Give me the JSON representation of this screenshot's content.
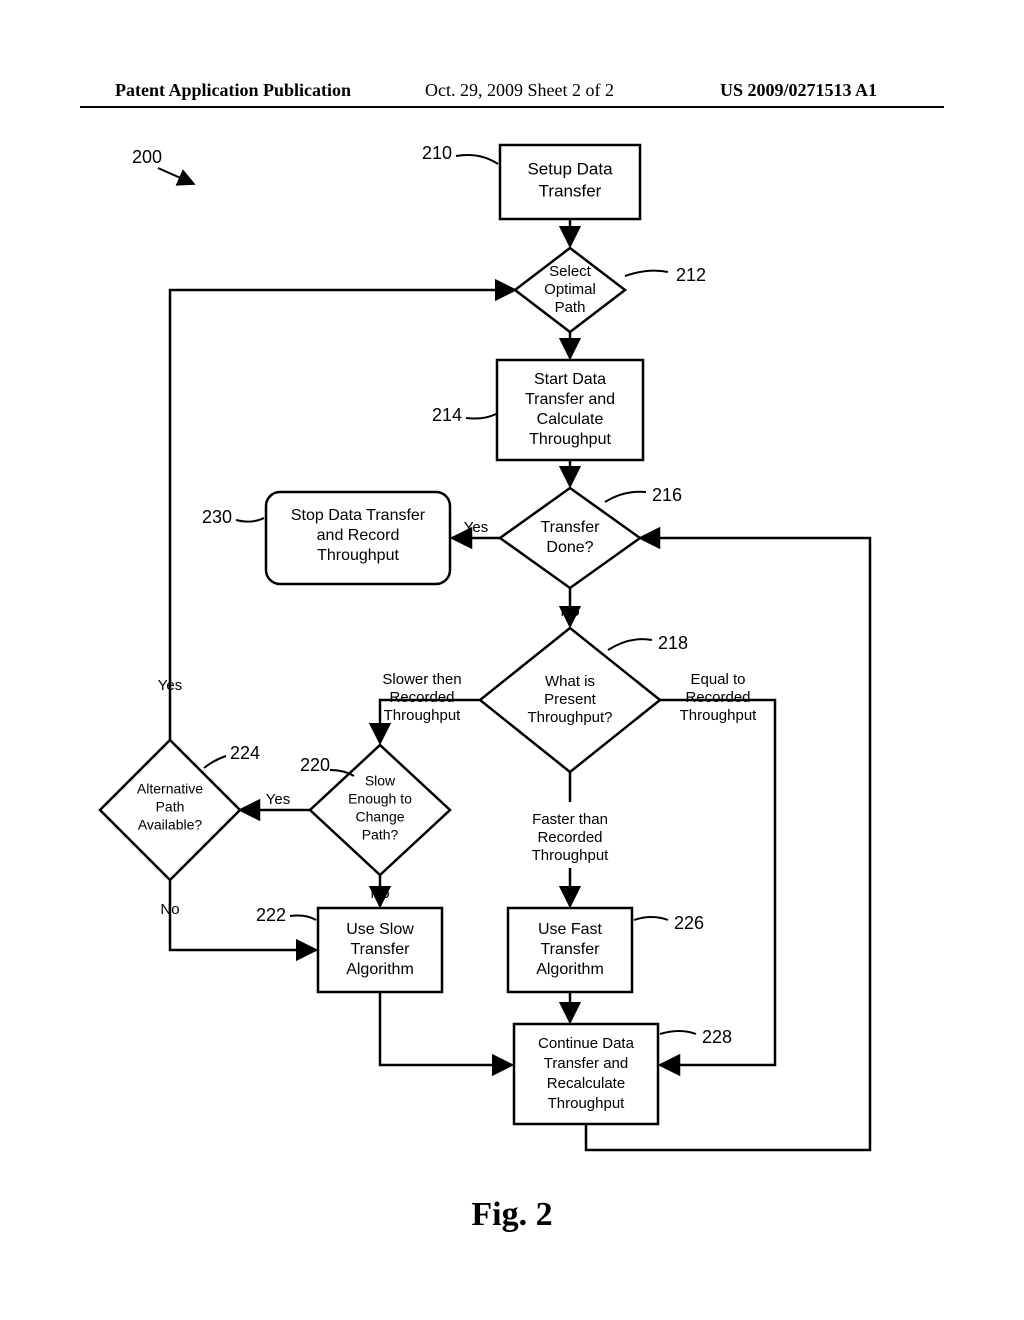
{
  "header": {
    "left": "Patent Application Publication",
    "mid": "Oct. 29, 2009  Sheet 2 of 2",
    "right": "US 2009/0271513 A1"
  },
  "caption": "Fig. 2",
  "refs": {
    "r200": "200",
    "r210": "210",
    "r212": "212",
    "r214": "214",
    "r216": "216",
    "r218": "218",
    "r220": "220",
    "r222": "222",
    "r224": "224",
    "r226": "226",
    "r228": "228",
    "r230": "230"
  },
  "nodes": {
    "n210": {
      "l1": "Setup Data",
      "l2": "Transfer"
    },
    "n212": {
      "l1": "Select",
      "l2": "Optimal",
      "l3": "Path"
    },
    "n214": {
      "l1": "Start Data",
      "l2": "Transfer and",
      "l3": "Calculate",
      "l4": "Throughput"
    },
    "n216": {
      "l1": "Transfer",
      "l2": "Done?"
    },
    "n218": {
      "l1": "What is",
      "l2": "Present",
      "l3": "Throughput?"
    },
    "n220": {
      "l1": "Slow",
      "l2": "Enough to",
      "l3": "Change",
      "l4": "Path?"
    },
    "n222": {
      "l1": "Use Slow",
      "l2": "Transfer",
      "l3": "Algorithm"
    },
    "n224": {
      "l1": "Alternative",
      "l2": "Path",
      "l3": "Available?"
    },
    "n226": {
      "l1": "Use Fast",
      "l2": "Transfer",
      "l3": "Algorithm"
    },
    "n228": {
      "l1": "Continue Data",
      "l2": "Transfer and",
      "l3": "Recalculate",
      "l4": "Throughput"
    },
    "n230": {
      "l1": "Stop Data Transfer",
      "l2": "and Record",
      "l3": "Throughput"
    }
  },
  "edges": {
    "yes": "Yes",
    "no": "No",
    "slower": {
      "l1": "Slower then",
      "l2": "Recorded",
      "l3": "Throughput"
    },
    "equal": {
      "l1": "Equal to",
      "l2": "Recorded",
      "l3": "Throughput"
    },
    "faster": {
      "l1": "Faster than",
      "l2": "Recorded",
      "l3": "Throughput"
    }
  }
}
